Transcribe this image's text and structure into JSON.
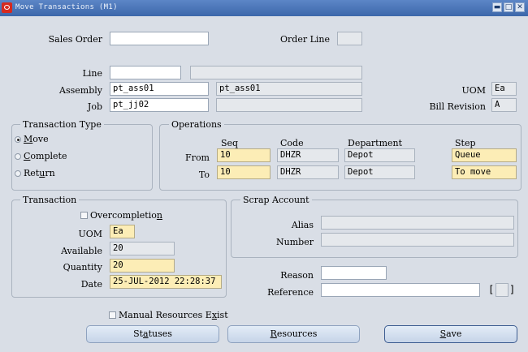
{
  "window": {
    "title": "Move Transactions (M1)",
    "controls": {
      "minimize": "▬",
      "maximize": "□",
      "close": "✕"
    }
  },
  "header": {
    "sales_order": {
      "label": "Sales Order",
      "value": ""
    },
    "order_line": {
      "label": "Order Line",
      "value": ""
    },
    "line": {
      "label": "Line",
      "value": "",
      "description": ""
    },
    "assembly": {
      "label": "Assembly",
      "value": "pt_ass01",
      "description": "pt_ass01"
    },
    "job": {
      "label": "Job",
      "value": "pt_jj02",
      "description": ""
    },
    "uom": {
      "label": "UOM",
      "value": "Ea"
    },
    "bill_revision": {
      "label": "Bill Revision",
      "value": "A"
    }
  },
  "transaction_type": {
    "title": "Transaction Type",
    "options": [
      {
        "label": "Move",
        "selected": true
      },
      {
        "label": "Complete",
        "selected": false
      },
      {
        "label": "Return",
        "selected": false
      }
    ]
  },
  "operations": {
    "title": "Operations",
    "headers": {
      "seq": "Seq",
      "code": "Code",
      "department": "Department",
      "step": "Step"
    },
    "from": {
      "label": "From",
      "seq": "10",
      "code": "DHZR",
      "department": "Depot",
      "step": "Queue"
    },
    "to": {
      "label": "To",
      "seq": "10",
      "code": "DHZR",
      "department": "Depot",
      "step": "To move"
    }
  },
  "transaction": {
    "title": "Transaction",
    "overcompletion": {
      "label": "Overcompletion",
      "checked": false
    },
    "uom": {
      "label": "UOM",
      "value": "Ea"
    },
    "available": {
      "label": "Available",
      "value": "20"
    },
    "quantity": {
      "label": "Quantity",
      "value": "20"
    },
    "date": {
      "label": "Date",
      "value": "25-JUL-2012 22:28:37"
    }
  },
  "scrap_account": {
    "title": "Scrap Account",
    "alias": {
      "label": "Alias",
      "value": ""
    },
    "number": {
      "label": "Number",
      "value": ""
    }
  },
  "reason": {
    "label": "Reason",
    "value": ""
  },
  "reference": {
    "label": "Reference",
    "value": ""
  },
  "flex_field": {
    "open": "[",
    "close": "]",
    "value": ""
  },
  "manual_resources": {
    "label": "Manual Resources Exist",
    "checked": false
  },
  "buttons": {
    "statuses": "Statuses",
    "resources": "Resources",
    "save": "Save"
  },
  "colors": {
    "required": "#fcedb6",
    "readonly": "#e5e8ec",
    "background": "#d9dee6",
    "titlebar": "#4a75b8"
  }
}
